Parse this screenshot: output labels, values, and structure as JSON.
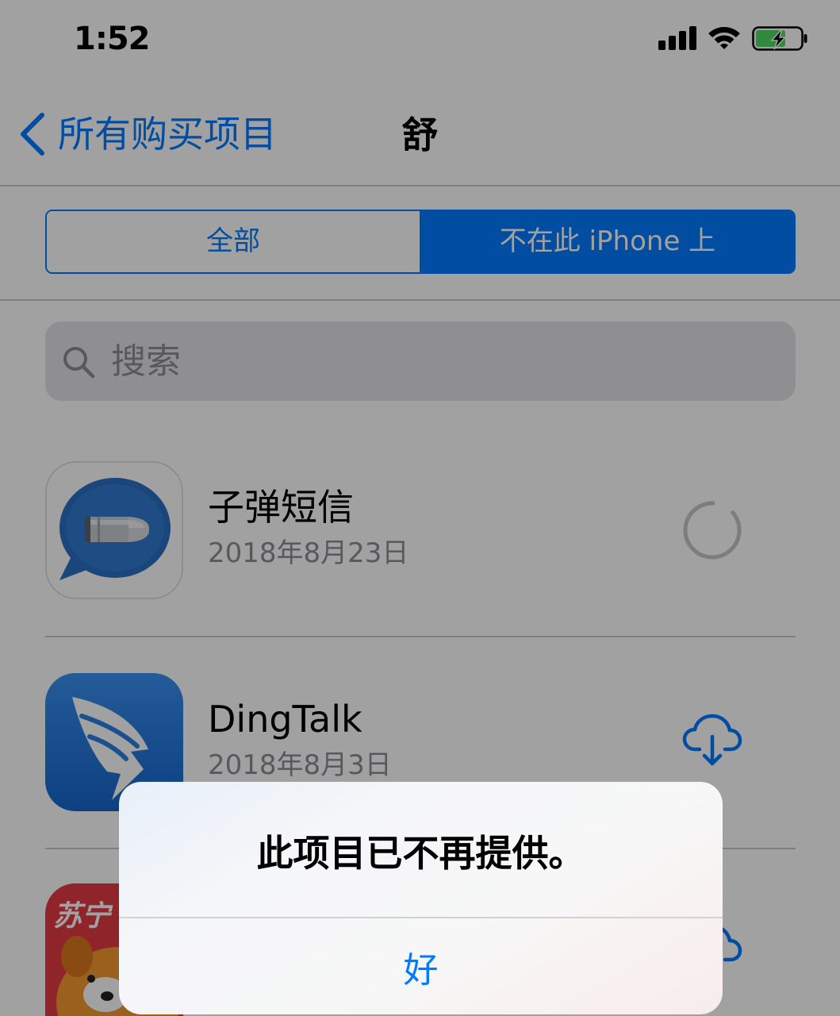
{
  "colors": {
    "accent": "#007aff",
    "battery": "#4cd964",
    "secondary": "#8e8e93"
  },
  "status_bar": {
    "time": "1:52",
    "icons": [
      "cellular-signal-icon",
      "wifi-icon",
      "battery-charging-icon"
    ]
  },
  "nav": {
    "back_icon": "chevron-left-icon",
    "back_label": "所有购买项目",
    "title": "舒"
  },
  "segmented": {
    "segments": [
      "全部",
      "不在此 iPhone 上"
    ],
    "selected_index": 1
  },
  "search": {
    "icon": "search-icon",
    "placeholder": "搜索"
  },
  "apps": [
    {
      "icon": "bullet-messenger-app-icon",
      "name": "子弹短信",
      "date": "2018年8月23日",
      "action_icon": "loading-spinner-icon"
    },
    {
      "icon": "dingtalk-app-icon",
      "name": "DingTalk",
      "date": "2018年8月3日",
      "action_icon": "cloud-download-icon"
    },
    {
      "icon": "suning-app-icon",
      "icon_text": "苏宁",
      "action_icon": "cloud-download-icon"
    }
  ],
  "alert": {
    "message": "此项目已不再提供。",
    "button_label": "好"
  }
}
